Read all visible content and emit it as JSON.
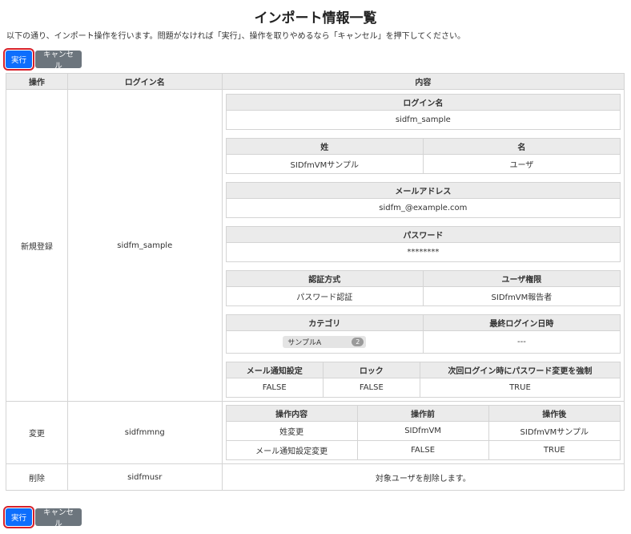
{
  "page": {
    "title": "インポート情報一覧",
    "description": "以下の通り、インポート操作を行います。問題がなければ「実行」、操作を取りやめるなら「キャンセル」を押下してください。"
  },
  "buttons": {
    "execute": "実行",
    "cancel": "キャンセル"
  },
  "main_table": {
    "headers": [
      "操作",
      "ログイン名",
      "内容"
    ],
    "rows": [
      {
        "operation": "新規登録",
        "login": "sidfm_sample",
        "details": {
          "login_name": {
            "header": "ログイン名",
            "value": "sidfm_sample"
          },
          "name": {
            "headers": [
              "姓",
              "名"
            ],
            "values": [
              "SIDfmVMサンプル",
              "ユーザ"
            ]
          },
          "email": {
            "header": "メールアドレス",
            "value": "sidfm_@example.com"
          },
          "password": {
            "header": "パスワード",
            "value": "********"
          },
          "auth": {
            "headers": [
              "認証方式",
              "ユーザ権限"
            ],
            "values": [
              "パスワード認証",
              "SIDfmVM報告者"
            ]
          },
          "category": {
            "headers": [
              "カテゴリ",
              "最終ログイン日時"
            ],
            "tag": "サンプルA",
            "count": "2",
            "last_login": "---"
          },
          "flags": {
            "headers": [
              "メール通知設定",
              "ロック",
              "次回ログイン時にパスワード変更を強制"
            ],
            "values": [
              "FALSE",
              "FALSE",
              "TRUE"
            ]
          }
        }
      },
      {
        "operation": "変更",
        "login": "sidfmmng",
        "changes": {
          "headers": [
            "操作内容",
            "操作前",
            "操作後"
          ],
          "rows": [
            [
              "姓変更",
              "SIDfmVM",
              "SIDfmVMサンプル"
            ],
            [
              "メール通知設定変更",
              "FALSE",
              "TRUE"
            ]
          ]
        }
      },
      {
        "operation": "削除",
        "login": "sidfmusr",
        "message": "対象ユーザを削除します。"
      }
    ]
  }
}
